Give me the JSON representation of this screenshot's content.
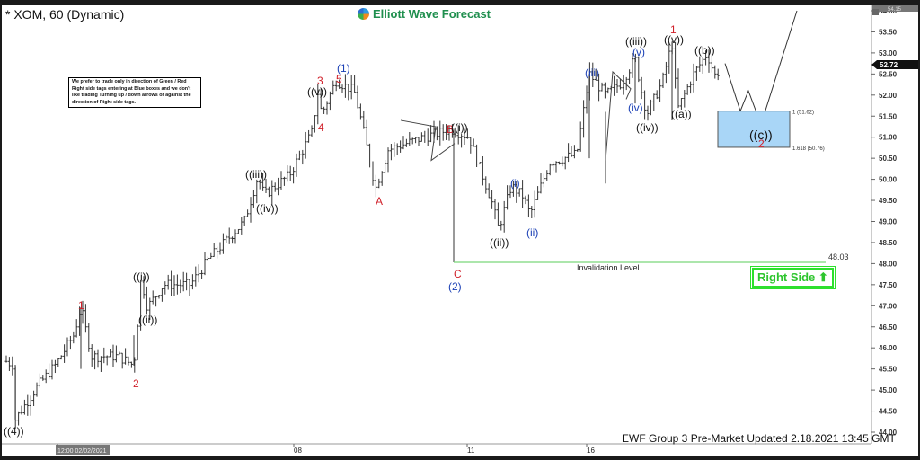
{
  "header": {
    "title": "* XOM, 60 (Dynamic)",
    "logo_text": "Elliott Wave Forecast"
  },
  "note": "We prefer to trade only in direction of Green / Red Right side tags entering at Blue boxes and we don't like trading Turning up / down arrows or against the direction of Right side tags.",
  "right_side_tag": {
    "label": "Right Side",
    "icon": "arrow-up-icon",
    "color": "#2ec52e"
  },
  "footer": "EWF Group 3 Pre-Market Updated 2.18.2021 13:45 GMT",
  "colors": {
    "red_label": "#d0202a",
    "blue_label": "#1a3fb5",
    "blue_box": "#a9d6f7",
    "invalidation_line": "#7ad87a"
  },
  "chart_data": {
    "type": "ohlc-bar",
    "symbol": "XOM",
    "interval": "60",
    "ylim": [
      44.0,
      54.0
    ],
    "y_ticks": [
      "44.00",
      "44.50",
      "45.00",
      "45.50",
      "46.00",
      "46.50",
      "47.00",
      "47.50",
      "48.00",
      "48.50",
      "49.00",
      "49.50",
      "50.00",
      "50.50",
      "51.00",
      "51.50",
      "52.00",
      "52.50",
      "53.00",
      "53.50",
      "54.00"
    ],
    "x_ticks": [
      "12:00 02/02/2021",
      "08",
      "11",
      "16"
    ],
    "last_price": "52.72",
    "top_price": "54.15",
    "invalidation": {
      "label": "Invalidation Level",
      "value": "48.03"
    },
    "fib_box": {
      "upper_label": "1 (51.62)",
      "lower_label": "1.618 (50.76)",
      "upper": 51.62,
      "lower": 50.76
    },
    "wave_labels": [
      {
        "text": "((4))",
        "color": "black",
        "price": 44.3
      },
      {
        "text": "1",
        "color": "red",
        "price": 46.96
      },
      {
        "text": "2",
        "color": "red",
        "price": 45.58
      },
      {
        "text": "((i))",
        "color": "black",
        "price": 47.67
      },
      {
        "text": "((ii))",
        "color": "black",
        "price": 46.96
      },
      {
        "text": "((iii))",
        "color": "black",
        "price": 50.06
      },
      {
        "text": "((iv))",
        "color": "black",
        "price": 49.63
      },
      {
        "text": "((v))",
        "color": "black",
        "price": 52.08
      },
      {
        "text": "3",
        "color": "red",
        "price": 52.08
      },
      {
        "text": "4",
        "color": "red",
        "price": 51.55
      },
      {
        "text": "5",
        "color": "red",
        "price": 52.34
      },
      {
        "text": "(1)",
        "color": "blue",
        "price": 52.34
      },
      {
        "text": "A",
        "color": "red",
        "price": 49.78
      },
      {
        "text": "B",
        "color": "red",
        "price": 51.19
      },
      {
        "text": "((i))",
        "color": "black",
        "price": 51.19
      },
      {
        "text": "C",
        "color": "red",
        "price": 48.03
      },
      {
        "text": "(2)",
        "color": "blue",
        "price": 48.03
      },
      {
        "text": "((ii))",
        "color": "black",
        "price": 48.82
      },
      {
        "text": "(i)",
        "color": "blue",
        "price": 49.84
      },
      {
        "text": "(ii)",
        "color": "blue",
        "price": 49.16
      },
      {
        "text": "(iii)",
        "color": "blue",
        "price": 52.5
      },
      {
        "text": "(iv)",
        "color": "blue",
        "price": 50.5
      },
      {
        "text": "((iii))",
        "color": "black",
        "price": 52.87
      },
      {
        "text": "(v)",
        "color": "blue",
        "price": 52.87
      },
      {
        "text": "((iv))",
        "color": "black",
        "price": 51.55
      },
      {
        "text": "1",
        "color": "red",
        "price": 53.25
      },
      {
        "text": "((v))",
        "color": "black",
        "price": 53.25
      },
      {
        "text": "((a))",
        "color": "black",
        "price": 51.65
      },
      {
        "text": "((b))",
        "color": "black",
        "price": 52.98
      },
      {
        "text": "((c))",
        "color": "black",
        "price": 51.3
      },
      {
        "text": "2",
        "color": "red",
        "price": 51.3
      }
    ],
    "grid": false
  }
}
